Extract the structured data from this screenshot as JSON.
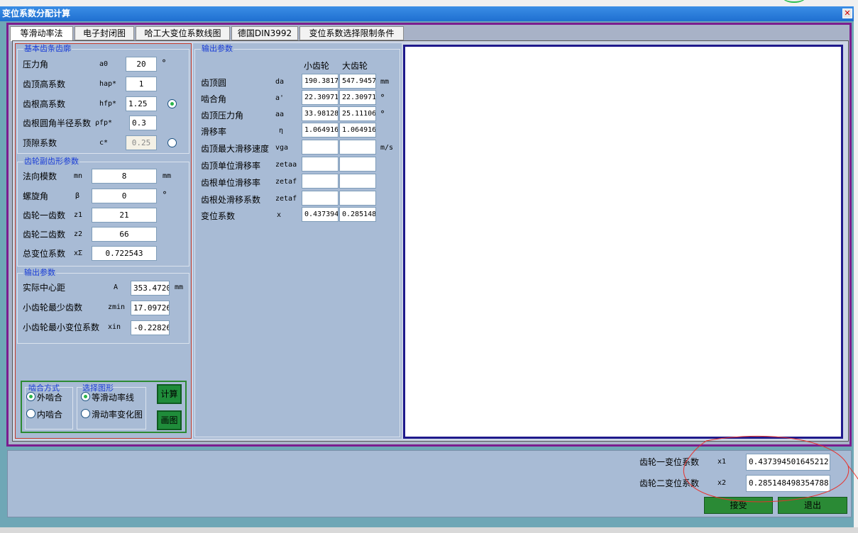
{
  "window": {
    "title": "变位系数分配计算",
    "close": "✕"
  },
  "tabs": [
    {
      "label": "等滑动率法"
    },
    {
      "label": "电子封闭图"
    },
    {
      "label": "哈工大变位系数线图"
    },
    {
      "label": "德国DIN3992"
    },
    {
      "label": "变位系数选择限制条件"
    }
  ],
  "basic": {
    "title": "基本齿条齿廓",
    "rows": [
      {
        "label": "压力角",
        "sym": "a0",
        "value": "20",
        "unit": "°"
      },
      {
        "label": "齿顶高系数",
        "sym": "hap*",
        "value": "1",
        "unit": ""
      },
      {
        "label": "齿根高系数",
        "sym": "hfp*",
        "value": "1.25",
        "unit": ""
      },
      {
        "label": "齿根圆角半径系数",
        "sym": "ρfp*",
        "value": "0.3",
        "unit": ""
      },
      {
        "label": "顶隙系数",
        "sym": "c*",
        "value": "0.25",
        "unit": ""
      }
    ]
  },
  "pair": {
    "title": "齿轮副齿形参数",
    "rows": [
      {
        "label": "法向模数",
        "sym": "mn",
        "value": "8",
        "unit": "mm"
      },
      {
        "label": "螺旋角",
        "sym": "β",
        "value": "0",
        "unit": "°"
      },
      {
        "label": "齿轮一齿数",
        "sym": "z1",
        "value": "21",
        "unit": ""
      },
      {
        "label": "齿轮二齿数",
        "sym": "z2",
        "value": "66",
        "unit": ""
      },
      {
        "label": "总变位系数",
        "sym": "xΣ",
        "value": "0.722543",
        "unit": ""
      }
    ]
  },
  "out1": {
    "title": "输出参数",
    "rows": [
      {
        "label": "实际中心距",
        "sym": "A",
        "value": "353.4720",
        "unit": "mm"
      },
      {
        "label": "小齿轮最少齿数",
        "sym": "zmin",
        "value": "17.09726",
        "unit": ""
      },
      {
        "label": "小齿轮最小变位系数",
        "sym": "xin",
        "value": "-0.22826",
        "unit": ""
      }
    ]
  },
  "mesh": {
    "title": "啮合方式",
    "opt1": "外啮合",
    "opt2": "内啮合"
  },
  "graph": {
    "title": "选择图形",
    "opt1": "等滑动率线",
    "opt2": "滑动率变化图"
  },
  "buttons": {
    "calc": "计算",
    "draw": "画图",
    "accept": "接受",
    "exit": "退出"
  },
  "out2": {
    "title": "输出参数",
    "col_small": "小齿轮",
    "col_big": "大齿轮",
    "rows": [
      {
        "label": "齿顶圆",
        "sym": "da",
        "v1": "190.3817",
        "v2": "547.9457",
        "unit": "mm"
      },
      {
        "label": "啮合角",
        "sym": "a'",
        "v1": "22.30971",
        "v2": "22.30971",
        "unit": "°"
      },
      {
        "label": "齿顶压力角",
        "sym": "aa",
        "v1": "33.98128",
        "v2": "25.11106",
        "unit": "°"
      },
      {
        "label": "滑移率",
        "sym": "η",
        "v1": "1.064916",
        "v2": "1.064916",
        "unit": ""
      },
      {
        "label": "齿顶最大滑移速度",
        "sym": "vga",
        "v1": "",
        "v2": "",
        "unit": "m/s"
      },
      {
        "label": "齿顶单位滑移率",
        "sym": "zetaa",
        "v1": "",
        "v2": "",
        "unit": ""
      },
      {
        "label": "齿根单位滑移率",
        "sym": "zetaf",
        "v1": "",
        "v2": "",
        "unit": ""
      },
      {
        "label": "齿根处滑移系数",
        "sym": "zetaf",
        "v1": "",
        "v2": "",
        "unit": ""
      },
      {
        "label": "变位系数",
        "sym": "x",
        "v1": "0.437394",
        "v2": "0.285148",
        "unit": ""
      }
    ]
  },
  "result": {
    "x1_label": "齿轮一变位系数",
    "x1_sym": "x1",
    "x1_value": "0.437394501645212",
    "x2_label": "齿轮二变位系数",
    "x2_sym": "x2",
    "x2_value": "0.285148498354788"
  }
}
